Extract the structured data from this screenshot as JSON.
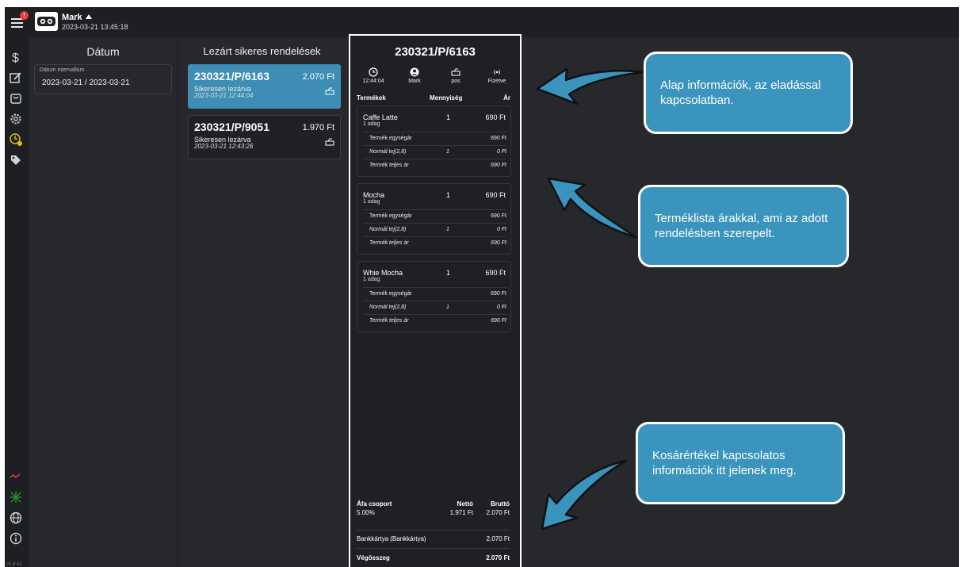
{
  "topbar": {
    "notification_count": "!",
    "user_name": "Mark",
    "datetime": "2023-03-21  13:45:18"
  },
  "sidebar": {
    "items": [
      {
        "icon": "dollar-icon"
      },
      {
        "icon": "edit-icon"
      },
      {
        "icon": "bag-icon"
      },
      {
        "icon": "gear-icon"
      },
      {
        "icon": "clock-alert-icon"
      },
      {
        "icon": "tag-icon"
      }
    ],
    "bottom_items": [
      {
        "icon": "printer-status-icon"
      },
      {
        "icon": "network-status-icon"
      },
      {
        "icon": "globe-icon"
      },
      {
        "icon": "info-icon"
      }
    ],
    "version": "v1.4.41"
  },
  "date_panel": {
    "title": "Dátum",
    "field_label": "Dátum intervallum",
    "field_value": "2023-03-21 / 2023-03-21"
  },
  "orders_panel": {
    "title": "Lezárt sikeres rendelések",
    "orders": [
      {
        "id": "230321/P/6163",
        "price": "2.070 Ft",
        "status": "Sikeresen lezárva",
        "time": "2023-03-21 12:44:04",
        "selected": true
      },
      {
        "id": "230321/P/9051",
        "price": "1.970 Ft",
        "status": "Sikeresen lezárva",
        "time": "2023-03-21 12:43:26",
        "selected": false
      }
    ]
  },
  "detail": {
    "title": "230321/P/6163",
    "info": [
      {
        "icon": "clock-icon",
        "value": "12:44:04"
      },
      {
        "icon": "user-icon",
        "value": "Mark"
      },
      {
        "icon": "pos-icon",
        "value": "pos"
      },
      {
        "icon": "contactless-icon",
        "value": "Fizetve"
      }
    ],
    "headers": {
      "product": "Termékek",
      "qty": "Mennyiség",
      "price": "Ár"
    },
    "products": [
      {
        "name": "Caffe Latte",
        "unit": "1 adag",
        "qty": "1",
        "price": "690 Ft",
        "rows": [
          {
            "label": "Termék egységár",
            "qty": "",
            "price": "690 Ft",
            "italic": false
          },
          {
            "label": "Normál tej(2,8)",
            "qty": "1",
            "price": "0 Ft",
            "italic": true
          },
          {
            "label": "Termék teljes ár",
            "qty": "",
            "price": "690 Ft",
            "italic": true
          }
        ]
      },
      {
        "name": "Mocha",
        "unit": "1 adag",
        "qty": "1",
        "price": "690 Ft",
        "rows": [
          {
            "label": "Termék egységár",
            "qty": "",
            "price": "690 Ft",
            "italic": false
          },
          {
            "label": "Normál tej(2,8)",
            "qty": "1",
            "price": "0 Ft",
            "italic": true
          },
          {
            "label": "Termék teljes ár",
            "qty": "",
            "price": "690 Ft",
            "italic": true
          }
        ]
      },
      {
        "name": "Whie Mocha",
        "unit": "1 adag",
        "qty": "1",
        "price": "690 Ft",
        "rows": [
          {
            "label": "Termék egységár",
            "qty": "",
            "price": "690 Ft",
            "italic": false
          },
          {
            "label": "Normál tej(2,8)",
            "qty": "1",
            "price": "0 Ft",
            "italic": true
          },
          {
            "label": "Termék teljes ár",
            "qty": "",
            "price": "690 Ft",
            "italic": true
          }
        ]
      }
    ],
    "vat": {
      "group_label": "Áfa csoport",
      "net_label": "Nettó",
      "gross_label": "Bruttó",
      "group_value": "5.00%",
      "net_value": "1.971 Ft",
      "gross_value": "2.070 Ft"
    },
    "payment": {
      "label": "Bankkártya (Bankkártya)",
      "value": "2.070 Ft"
    },
    "total": {
      "label": "Végösszeg",
      "value": "2.070 Ft"
    }
  },
  "callouts": [
    "Alap információk, az eladással kapcsolatban.",
    "Terméklista árakkal, ami az adott rendelésben szerepelt.",
    "Kosárértékel kapcsolatos információk itt jelenek meg."
  ],
  "colors": {
    "accent": "#3a94bd",
    "selected": "#3d8db5",
    "background": "#26282c",
    "alert": "#e53935"
  }
}
